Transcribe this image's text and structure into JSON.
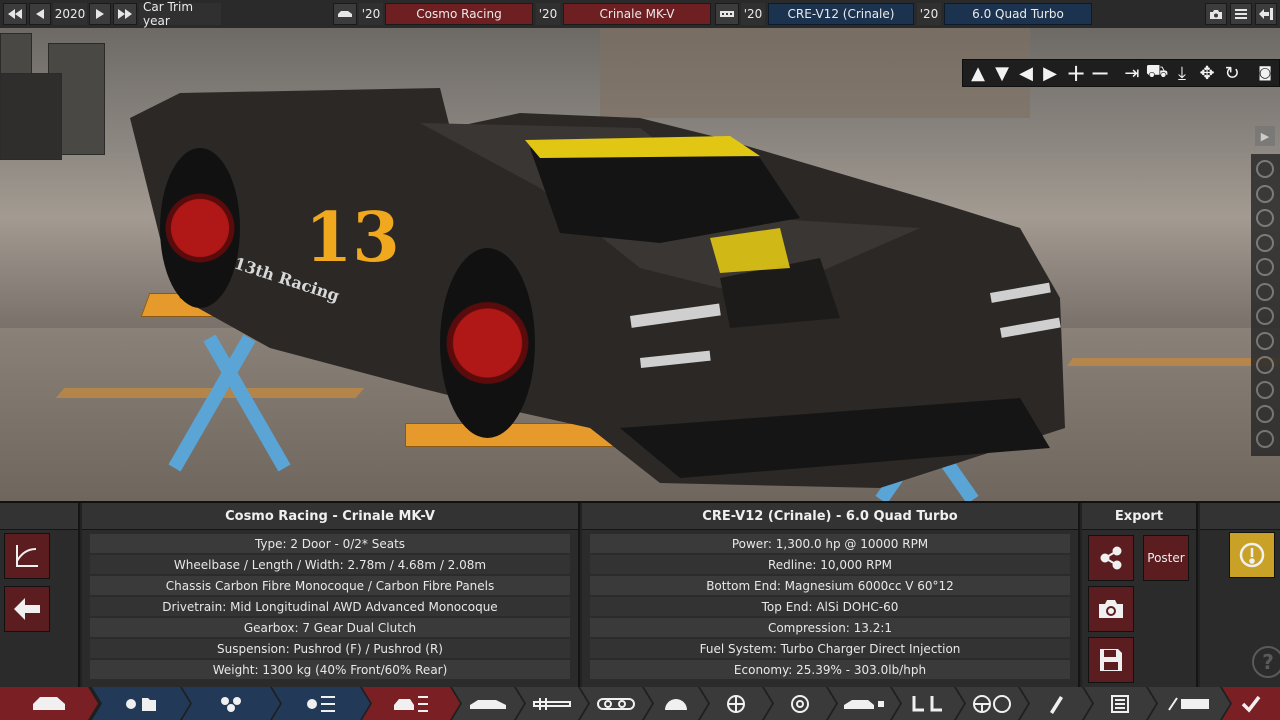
{
  "topbar": {
    "year": "2020",
    "trim_label": "Car Trim year",
    "model_year_1": "'20",
    "manufacturer": "Cosmo Racing",
    "model_year_2": "'20",
    "model": "Crinale MK-V",
    "engine_year_1": "'20",
    "engine_family": "CRE-V12 (Crinale)",
    "engine_year_2": "'20",
    "engine_variant": "6.0 Quad Turbo"
  },
  "scene": {
    "race_number": "13",
    "livery_text": "13th Racing"
  },
  "car_panel": {
    "title": "Cosmo Racing - Crinale MK-V",
    "rows": [
      "Type: 2 Door - 0/2* Seats",
      "Wheelbase / Length / Width: 2.78m / 4.68m / 2.08m",
      "Chassis Carbon Fibre Monocoque / Carbon Fibre Panels",
      "Drivetrain: Mid Longitudinal AWD Advanced Monocoque",
      "Gearbox: 7 Gear Dual Clutch",
      "Suspension: Pushrod (F) / Pushrod (R)",
      "Weight: 1300 kg (40% Front/60% Rear)"
    ]
  },
  "engine_panel": {
    "title": "CRE-V12 (Crinale) - 6.0 Quad Turbo",
    "rows": [
      "Power: 1,300.0 hp @ 10000 RPM",
      "Redline:  10,000 RPM",
      "Bottom End: Magnesium 6000cc V 60°12",
      "Top End: AlSi DOHC-60",
      "Compression: 13.2:1",
      "Fuel System: Turbo Charger Direct Injection",
      "Economy: 25.39% - 303.0lb/hph"
    ]
  },
  "export_panel": {
    "title": "Export",
    "poster_label": "Poster"
  },
  "colors": {
    "accent_red": "#7a2024",
    "accent_blue": "#223a58",
    "warning_gold": "#c9a126"
  }
}
